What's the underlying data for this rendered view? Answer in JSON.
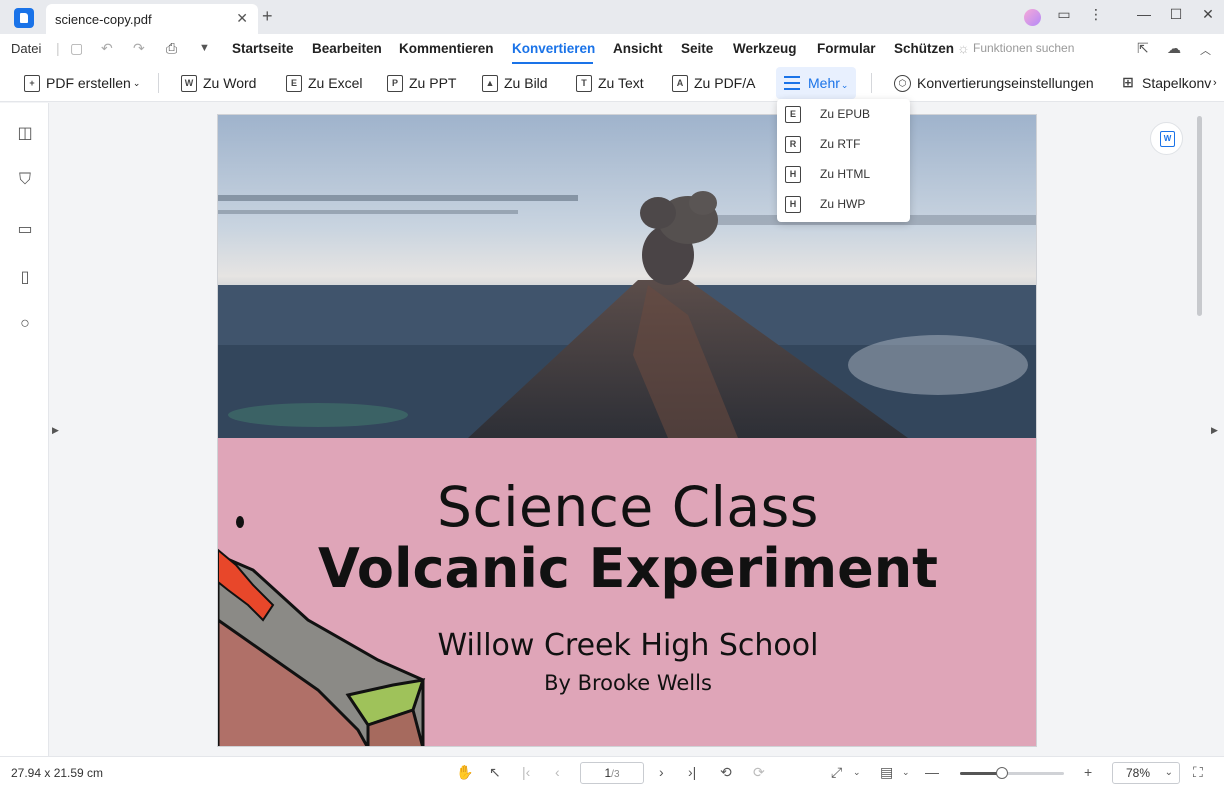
{
  "window": {
    "tab_title": "science-copy.pdf",
    "tab_close": "✕",
    "tab_add": "+"
  },
  "menubar": {
    "file": "Datei",
    "items": [
      "Startseite",
      "Bearbeiten",
      "Kommentieren",
      "Konvertieren",
      "Ansicht",
      "Seite",
      "Werkzeug",
      "Formular",
      "Schützen"
    ],
    "active": "Konvertieren",
    "search_hint": "Funktionen suchen"
  },
  "toolbar": {
    "pdf_create": "PDF erstellen",
    "to_word": "Zu Word",
    "to_excel": "Zu Excel",
    "to_ppt": "Zu PPT",
    "to_image": "Zu Bild",
    "to_text": "Zu Text",
    "to_pdfa": "Zu PDF/A",
    "more": "Mehr",
    "settings": "Konvertierungseinstellungen",
    "batch": "Stapelkonv"
  },
  "more_menu": {
    "items": [
      {
        "icon": "E",
        "label": "Zu EPUB"
      },
      {
        "icon": "R",
        "label": "Zu RTF"
      },
      {
        "icon": "H",
        "label": "Zu HTML"
      },
      {
        "icon": "H",
        "label": "Zu HWP"
      }
    ]
  },
  "document": {
    "title_line1": "Science Class",
    "title_line2": "Volcanic Experiment",
    "school": "Willow Creek High School",
    "author": "By Brooke Wells"
  },
  "statusbar": {
    "dimensions": "27.94 x 21.59 cm",
    "page_current": "1",
    "page_total": "/3",
    "zoom": "78%",
    "zoom_level": 0.4
  },
  "colors": {
    "accent": "#1a73e8",
    "pink_panel": "#dfa5b8"
  }
}
